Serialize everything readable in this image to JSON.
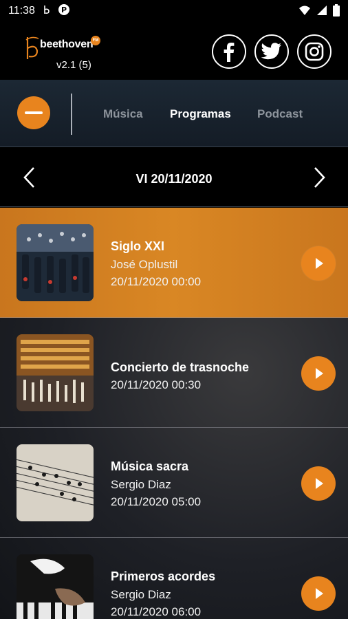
{
  "status": {
    "time": "11:38"
  },
  "header": {
    "logo_text": "beethoven",
    "logo_badge": "FM",
    "version": "v2.1 (5)"
  },
  "nav": {
    "tabs": [
      {
        "label": "Música",
        "active": false
      },
      {
        "label": "Programas",
        "active": true
      },
      {
        "label": "Podcast",
        "active": false
      }
    ]
  },
  "date": {
    "label": "VI 20/11/2020"
  },
  "programs": [
    {
      "title": "Siglo XXI",
      "host": "José Oplustil",
      "datetime": "20/11/2020 00:00",
      "active": true,
      "image": "mixing-console"
    },
    {
      "title": "Concierto de trasnoche",
      "host": "",
      "datetime": "20/11/2020 00:30",
      "active": false,
      "image": "opera-house"
    },
    {
      "title": "Música sacra",
      "host": "Sergio Diaz",
      "datetime": "20/11/2020 05:00",
      "active": false,
      "image": "sheet-music"
    },
    {
      "title": "Primeros acordes",
      "host": "Sergio Diaz",
      "datetime": "20/11/2020 06:00",
      "active": false,
      "image": "piano-hands"
    }
  ],
  "colors": {
    "accent": "#e8841e",
    "active_tab": "#ffffff",
    "inactive_tab": "#8d949c"
  }
}
